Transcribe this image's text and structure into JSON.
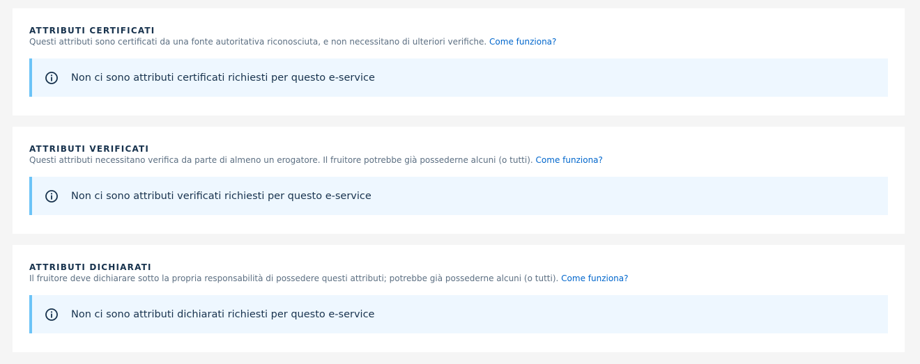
{
  "sections": [
    {
      "title": "ATTRIBUTI CERTIFICATI",
      "description": "Questi attributi sono certificati da una fonte autoritativa riconosciuta, e non necessitano di ulteriori verifiche.",
      "link_label": "Come funziona?",
      "empty_message": "Non ci sono attributi certificati richiesti per questo e-service",
      "icon": "info-icon"
    },
    {
      "title": "ATTRIBUTI VERIFICATI",
      "description": "Questi attributi necessitano verifica da parte di almeno un erogatore. Il fruitore potrebbe già possederne alcuni (o tutti).",
      "link_label": "Come funziona?",
      "empty_message": "Non ci sono attributi verificati richiesti per questo e-service",
      "icon": "info-icon"
    },
    {
      "title": "ATTRIBUTI DICHIARATI",
      "description": "Il fruitore deve dichiarare sotto la propria responsabilità di possedere questi attributi; potrebbe già possederne alcuni (o tutti).",
      "link_label": "Come funziona?",
      "empty_message": "Non ci sono attributi dichiarati richiesti per questo e-service",
      "icon": "info-icon"
    }
  ],
  "colors": {
    "page_background": "#f5f5f5",
    "card_background": "#ffffff",
    "title_text": "#17324d",
    "description_text": "#5c6f82",
    "link": "#0066cc",
    "alert_background": "#eef7ff",
    "alert_border": "#6cc3f7"
  }
}
